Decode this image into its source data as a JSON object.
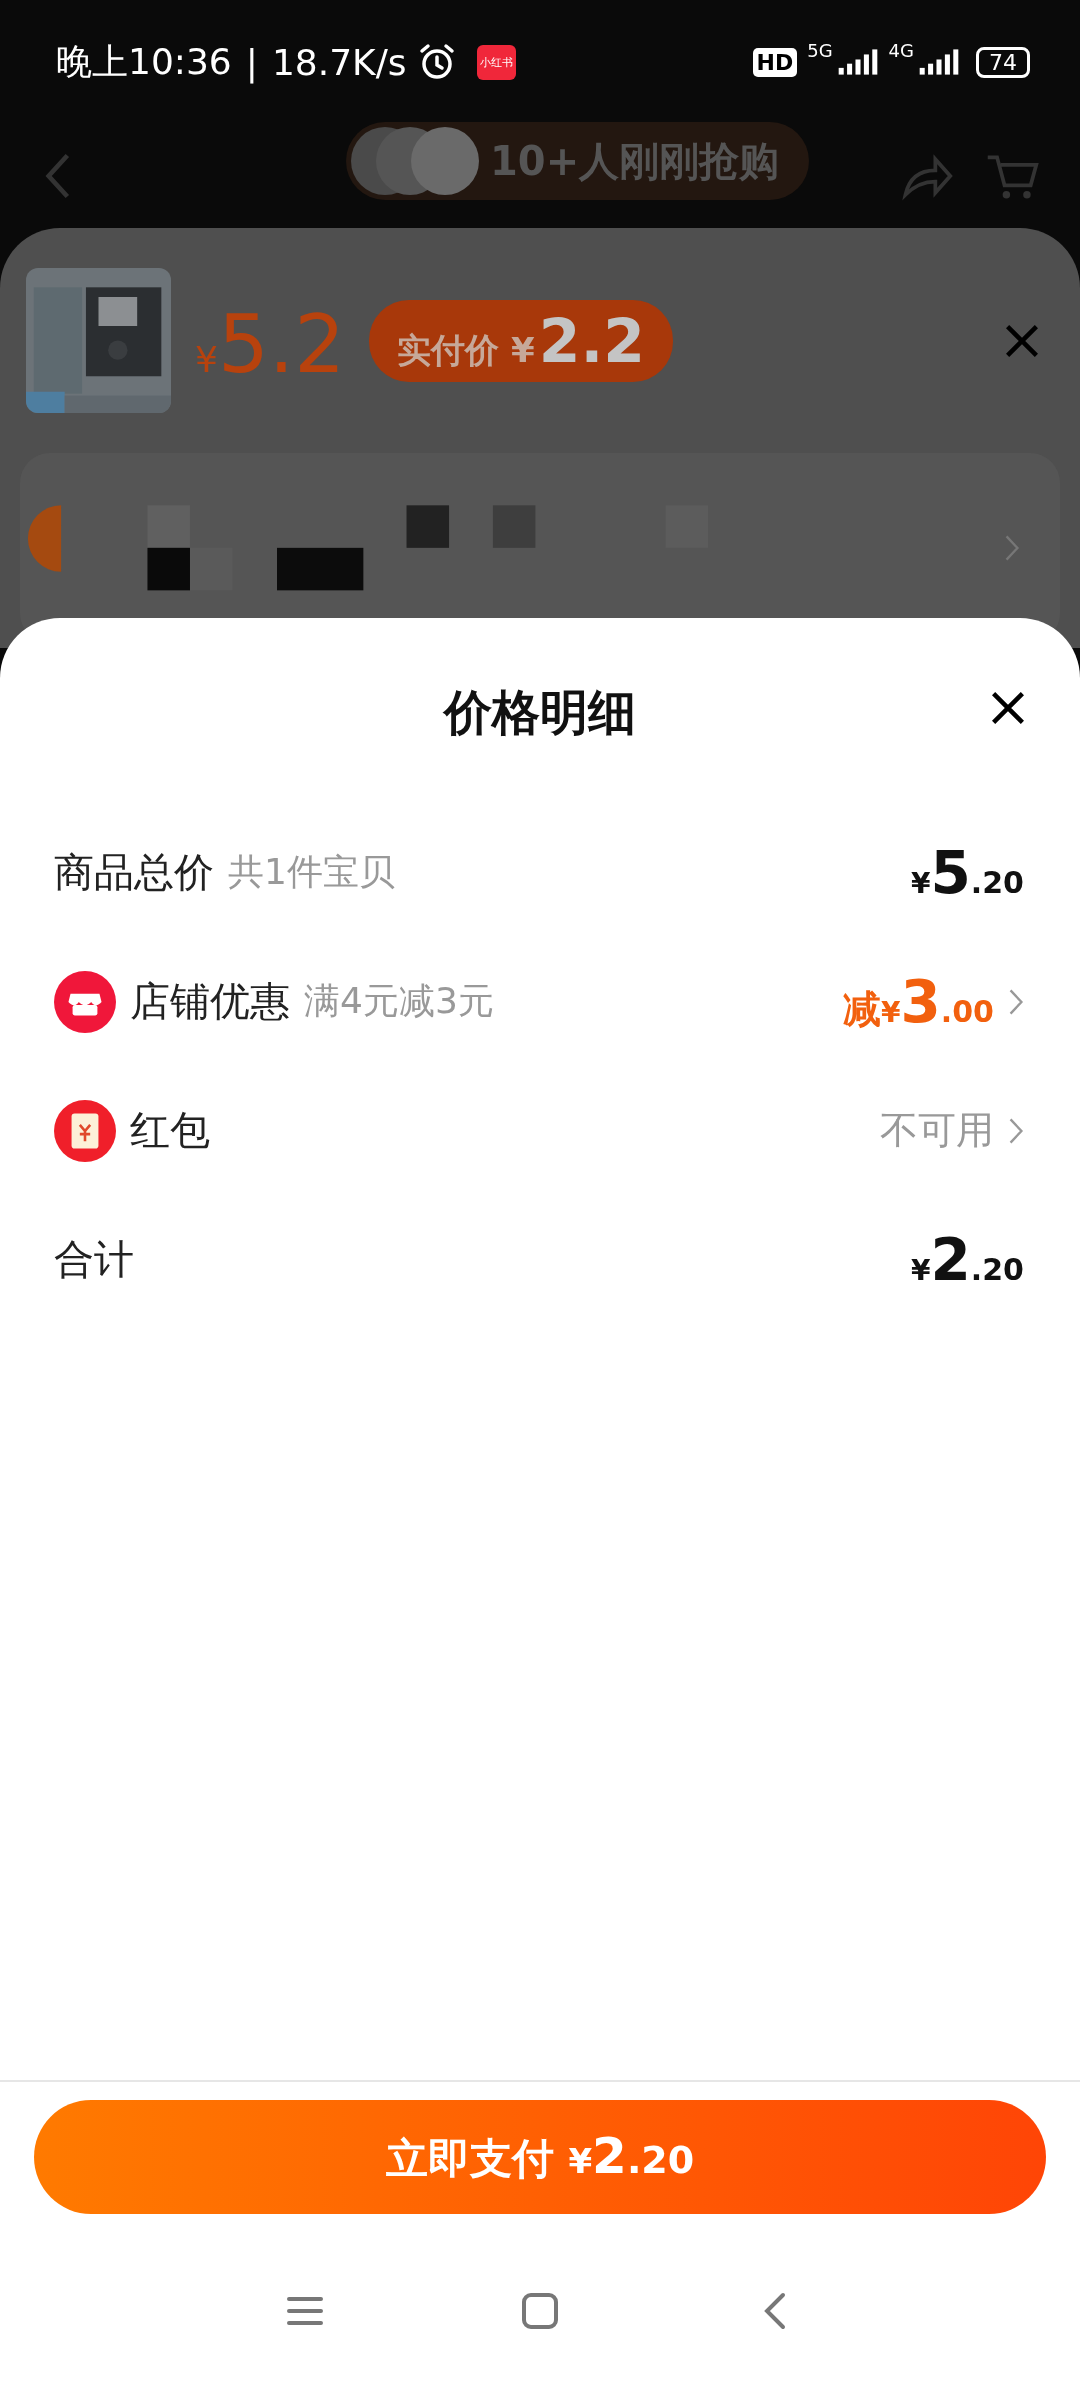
{
  "status_bar": {
    "time": "晚上10:36",
    "separator": "|",
    "speed": "18.7K/s",
    "app_badge": "小红书",
    "hd": "HD",
    "network_1": "5G",
    "network_2": "4G",
    "battery": "74"
  },
  "background": {
    "buyers_note": "10+人刚刚抢购"
  },
  "product_sheet": {
    "price_currency": "¥",
    "price": "5.2",
    "paid_label": "实付价 ¥",
    "paid_price": "2.2"
  },
  "price_detail": {
    "title": "价格明细",
    "rows": [
      {
        "label": "商品总价",
        "note": "共1件宝贝",
        "value": {
          "currency": "¥",
          "integer": "5",
          "decimal": ".20",
          "highlight": false
        },
        "chevron": false
      },
      {
        "kind": "shop",
        "label": "店铺优惠",
        "note": "满4元减3元",
        "value": {
          "prefix": "减",
          "currency": "¥",
          "integer": "3",
          "decimal": ".00",
          "highlight": true
        },
        "chevron": true
      },
      {
        "kind": "redpacket",
        "label": "红包",
        "value_text": "不可用",
        "chevron": true
      },
      {
        "label": "合计",
        "value": {
          "currency": "¥",
          "integer": "2",
          "decimal": ".20",
          "highlight": false
        },
        "chevron": false
      }
    ]
  },
  "pay_button": {
    "label": "立即支付",
    "currency": "¥",
    "integer": "2",
    "decimal": ".20"
  }
}
